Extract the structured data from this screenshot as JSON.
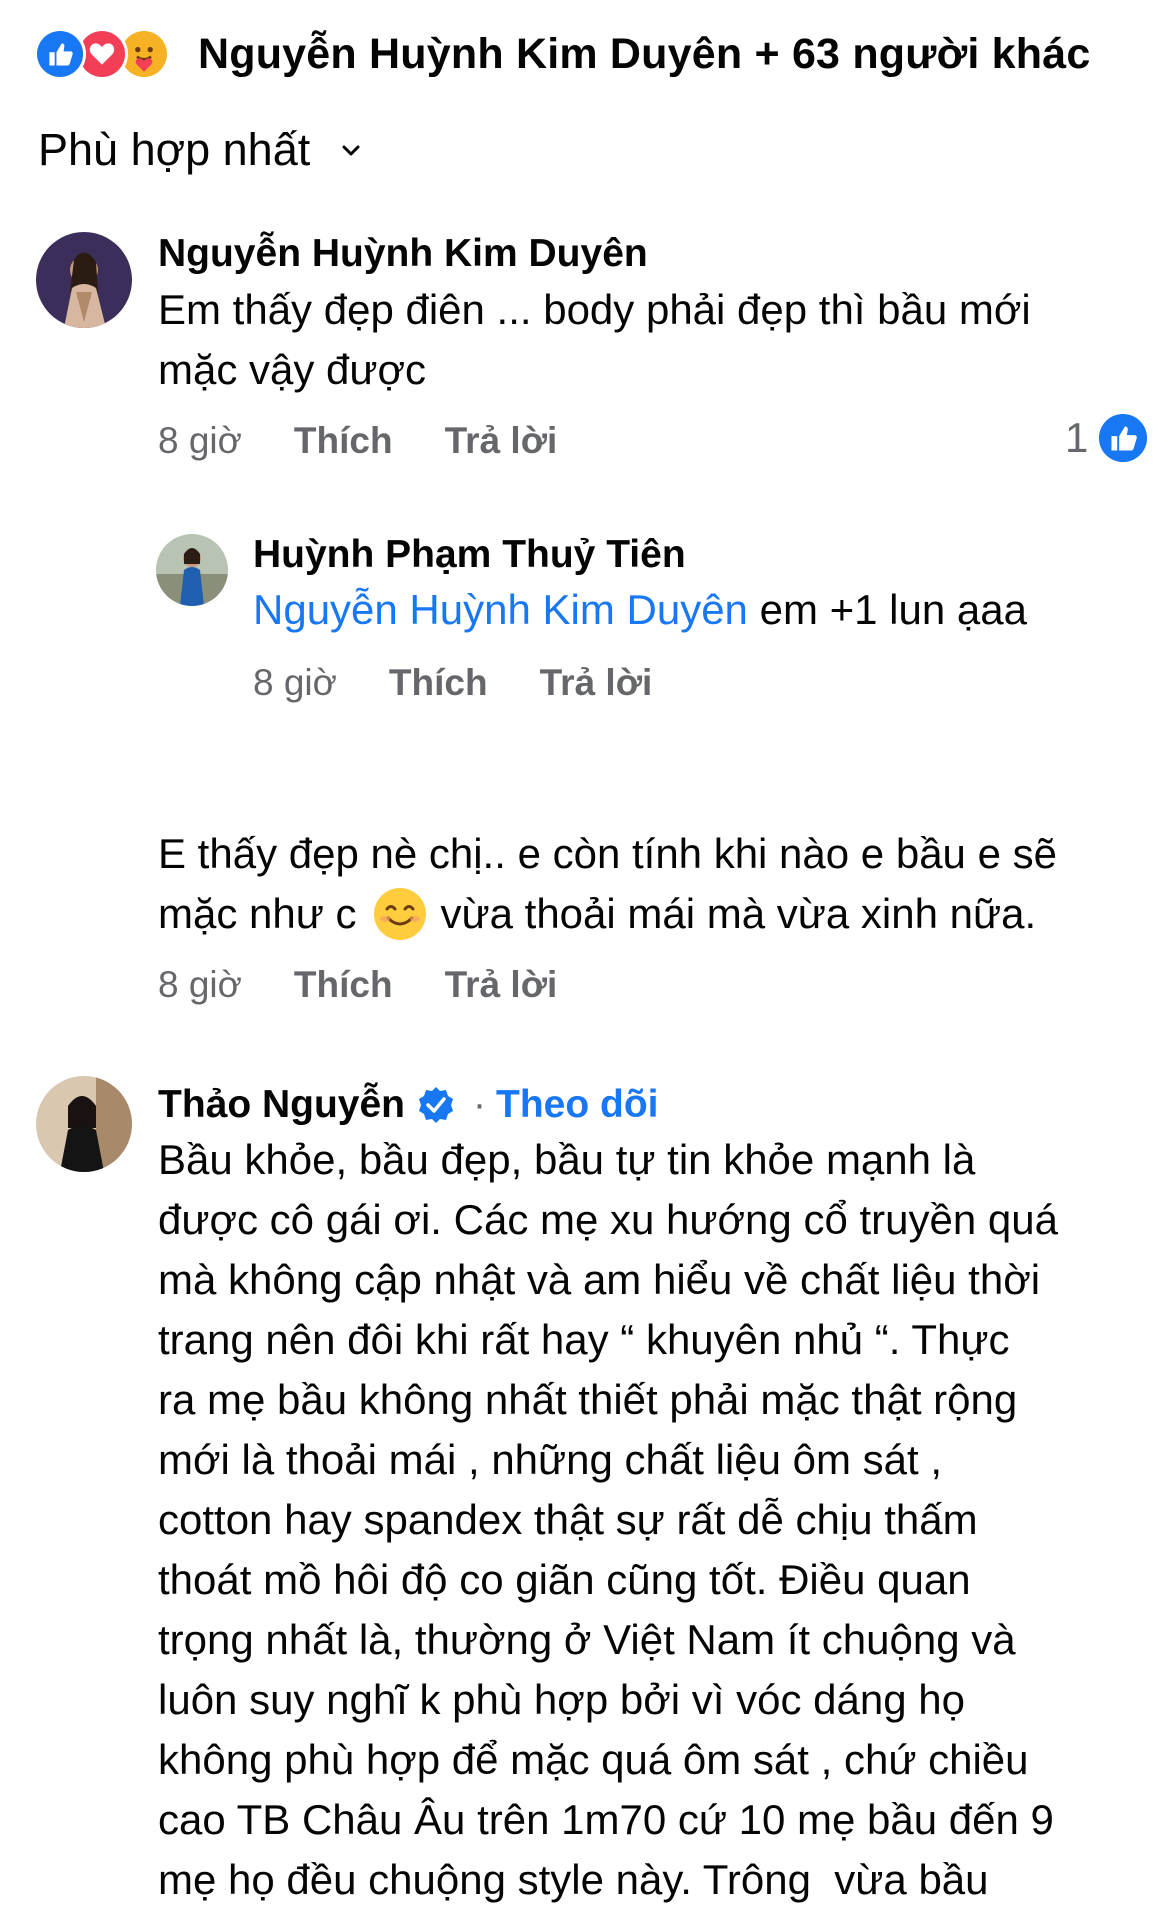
{
  "reactions": {
    "icons": [
      "like-reaction-icon",
      "love-reaction-icon",
      "care-reaction-icon"
    ],
    "summary": "Nguyễn Huỳnh Kim Duyên + 63 người khác"
  },
  "sort": {
    "label": "Phù hợp nhất"
  },
  "comments": [
    {
      "author": "Nguyễn Huỳnh Kim Duyên",
      "text_line1": "Em thấy đẹp điên ... body phải đẹp thì bầu mới",
      "text_line2": "mặc vậy được",
      "time": "8 giờ",
      "like_label": "Thích",
      "reply_label": "Trả lời",
      "reaction_count": "1"
    },
    {
      "author": "Huỳnh Phạm Thuỷ Tiên",
      "mention": "Nguyễn Huỳnh Kim Duyên",
      "text": " em +1 lun ạaa",
      "time": "8 giờ",
      "like_label": "Thích",
      "reply_label": "Trả lời"
    },
    {
      "text_line1": "E thấy đẹp nè chị.. e còn tính khi nào e bầu e sẽ",
      "text_line2a": "mặc như c",
      "text_line2b": "vừa thoải mái mà vừa xinh nữa.",
      "time": "8 giờ",
      "like_label": "Thích",
      "reply_label": "Trả lời"
    },
    {
      "author": "Thảo Nguyễn",
      "follow_label": "Theo dõi",
      "lines": [
        "Bầu khỏe, bầu đẹp, bầu tự tin khỏe mạnh là",
        "được cô gái ơi. Các mẹ xu hướng cổ truyền quá",
        "mà không cập nhật và am hiểu về chất liệu thời",
        "trang nên đôi khi rất hay “ khuyên nhủ “. Thực",
        "ra mẹ bầu không nhất thiết phải mặc thật rộng",
        "mới là thoải mái , những chất liệu ôm sát ,",
        "cotton hay spandex thật sự rất dễ chịu thấm",
        "thoát mồ hôi độ co giãn cũng tốt. Điều quan",
        "trọng nhất là, thường ở Việt Nam ít chuộng và",
        "luôn suy nghĩ k phù hợp bởi vì vóc dáng họ",
        "không phù hợp để mặc quá ôm sát , chứ chiều",
        "cao TB Châu Âu trên 1m70 cứ 10 mẹ bầu đến 9",
        "mẹ họ đều chuộng style này. Trông  vừa bầu"
      ]
    }
  ],
  "colors": {
    "accent": "#1877f2",
    "meta": "#65676b",
    "text": "#050505"
  }
}
